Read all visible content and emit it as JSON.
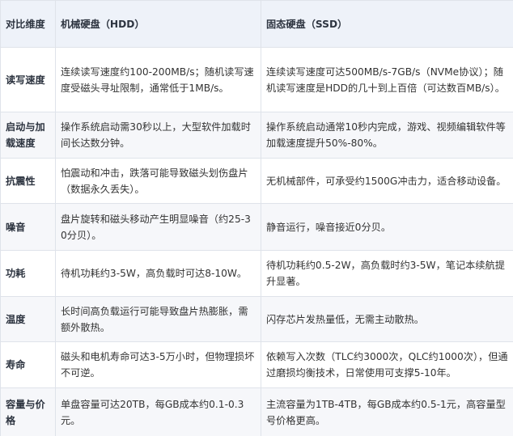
{
  "table": {
    "headers": {
      "dimension": "对比维度",
      "hdd": "机械硬盘（HDD）",
      "ssd": "固态硬盘（SSD）"
    },
    "rows": [
      {
        "dimension": "读写速度",
        "hdd": "连续读写速度约100-200MB/s；随机读写速度受磁头寻址限制，通常低于1MB/s。",
        "ssd": "连续读写速度可达500MB/s-7GB/s（NVMe协议）；随机读写速度是HDD的几十到上百倍（可达数百MB/s）。"
      },
      {
        "dimension": "启动与加载速度",
        "hdd": "操作系统启动需30秒以上，大型软件加载时间长达数分钟。",
        "ssd": "操作系统启动通常10秒内完成，游戏、视频编辑软件等加载速度提升50%-80%。"
      },
      {
        "dimension": "抗震性",
        "hdd": "怕震动和冲击，跌落可能导致磁头划伤盘片（数据永久丢失）。",
        "ssd": "无机械部件，可承受约1500G冲击力，适合移动设备。"
      },
      {
        "dimension": "噪音",
        "hdd": "盘片旋转和磁头移动产生明显噪音（约25-30分贝）。",
        "ssd": "静音运行，噪音接近0分贝。"
      },
      {
        "dimension": "功耗",
        "hdd": "待机功耗约3-5W，高负载时可达8-10W。",
        "ssd": "待机功耗约0.5-2W，高负载时约3-5W，笔记本续航提升显著。"
      },
      {
        "dimension": "温度",
        "hdd": "长时间高负载运行可能导致盘片热膨胀，需额外散热。",
        "ssd": "闪存芯片发热量低，无需主动散热。"
      },
      {
        "dimension": "寿命",
        "hdd": "磁头和电机寿命可达3-5万小时，但物理损坏不可逆。",
        "ssd": "依赖写入次数（TLC约3000次，QLC约1000次），但通过磨损均衡技术，日常使用可支撑5-10年。"
      },
      {
        "dimension": "容量与价格",
        "hdd": "单盘容量可达20TB，每GB成本约0.1-0.3元。",
        "ssd": "主流容量为1TB-4TB，每GB成本约0.5-1元，高容量型号价格更高。"
      }
    ]
  }
}
